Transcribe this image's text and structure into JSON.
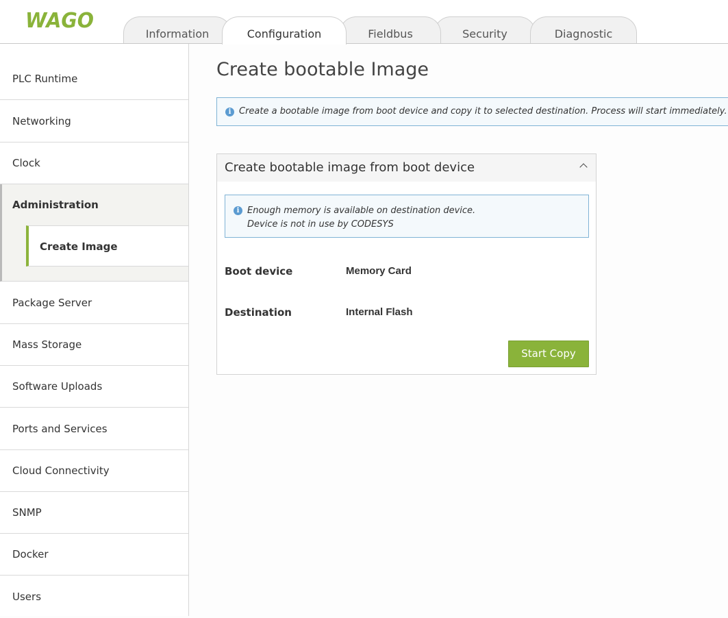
{
  "brand": {
    "logo_text": "WAGO",
    "accent_color": "#8ab33a"
  },
  "tabs": [
    {
      "label": "Information",
      "active": false
    },
    {
      "label": "Configuration",
      "active": true
    },
    {
      "label": "Fieldbus",
      "active": false
    },
    {
      "label": "Security",
      "active": false
    },
    {
      "label": "Diagnostic",
      "active": false
    }
  ],
  "sidebar": {
    "items": [
      {
        "label": "PLC Runtime"
      },
      {
        "label": "Networking"
      },
      {
        "label": "Clock"
      },
      {
        "label": "Administration",
        "expanded": true
      },
      {
        "label": "Package Server"
      },
      {
        "label": "Mass Storage"
      },
      {
        "label": "Software Uploads"
      },
      {
        "label": "Ports and Services"
      },
      {
        "label": "Cloud Connectivity"
      },
      {
        "label": "SNMP"
      },
      {
        "label": "Docker"
      },
      {
        "label": "Users"
      }
    ],
    "subitem": {
      "label": "Create Image",
      "selected": true
    }
  },
  "main": {
    "title": "Create bootable Image",
    "info": "Create a bootable image from boot device and copy it to selected destination. Process will start immediately.",
    "panel": {
      "title": "Create bootable image from boot device",
      "status_line1": "Enough memory is available on destination device.",
      "status_line2": "Device is not in use by CODESYS",
      "boot_label": "Boot device",
      "boot_value": "Memory Card",
      "dest_label": "Destination",
      "dest_value": "Internal Flash",
      "button": "Start Copy"
    }
  }
}
